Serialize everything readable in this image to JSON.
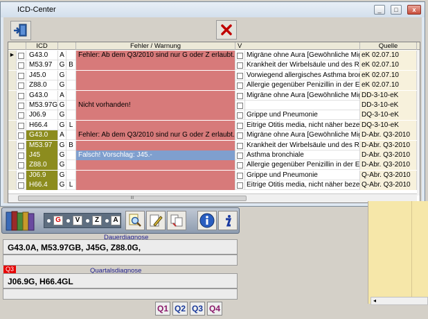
{
  "window": {
    "title": "ICD-Center",
    "btn_min": "_",
    "btn_max": "□",
    "btn_close": "x"
  },
  "grid": {
    "columns": {
      "icd": "ICD",
      "error": "Fehler / Warnung",
      "v": "V",
      "source": "Quelle"
    },
    "scroll_mark": "III",
    "rows": [
      {
        "icd": "G43.0",
        "k1": "A",
        "k2": "",
        "error": "Fehler: Ab dem Q3/2010 sind nur G oder Z erlaubt.",
        "desc": "Migräne ohne Aura [Gewöhnliche Migräne]",
        "source": "eK 02.07.10",
        "dark": false,
        "status": "error"
      },
      {
        "icd": "M53.97",
        "k1": "G",
        "k2": "B",
        "error": "",
        "desc": "Krankheit der Wirbelsäule und des Rückens",
        "source": "eK 02.07.10",
        "dark": false,
        "status": "error"
      },
      {
        "icd": "J45.0",
        "k1": "G",
        "k2": "",
        "error": "",
        "desc": "Vorwiegend allergisches Asthma bronchiale",
        "source": "eK 02.07.10",
        "dark": false,
        "status": "error"
      },
      {
        "icd": "Z88.0",
        "k1": "G",
        "k2": "",
        "error": "",
        "desc": "Allergie gegenüber Penizillin in der Eigenanamnese",
        "source": "eK 02.07.10",
        "dark": false,
        "status": "error"
      },
      {
        "icd": "G43.0",
        "k1": "A",
        "k2": "",
        "error": "",
        "desc": "Migräne ohne Aura [Gewöhnliche Migräne]",
        "source": "DD-3-10-eK",
        "dark": false,
        "status": "error"
      },
      {
        "icd": "M53.97G",
        "k1": "G",
        "k2": "",
        "error": "Nicht vorhanden!",
        "desc": "",
        "source": "DD-3-10-eK",
        "dark": false,
        "status": "error"
      },
      {
        "icd": "J06.9",
        "k1": "G",
        "k2": "",
        "error": "",
        "desc": "Grippe und Pneumonie",
        "source": "DQ-3-10-eK",
        "dark": false,
        "status": "error"
      },
      {
        "icd": "H66.4",
        "k1": "G",
        "k2": "L",
        "error": "",
        "desc": "Eitrige Otitis media, nicht näher bezeichnet",
        "source": "DQ-3-10-eK",
        "dark": false,
        "status": "error"
      },
      {
        "icd": "G43.0",
        "k1": "A",
        "k2": "",
        "error": "Fehler: Ab dem Q3/2010 sind nur G oder Z erlaubt.",
        "desc": "Migräne ohne Aura [Gewöhnliche Migräne]",
        "source": "D-Abr. Q3-2010",
        "dark": true,
        "status": "error"
      },
      {
        "icd": "M53.97",
        "k1": "G",
        "k2": "B",
        "error": "",
        "desc": "Krankheit der Wirbelsäule und des Rückens",
        "source": "D-Abr. Q3-2010",
        "dark": true,
        "status": "error"
      },
      {
        "icd": "J45",
        "k1": "G",
        "k2": "",
        "error": "Falsch!      Vorschlag: J45.-",
        "desc": "Asthma bronchiale",
        "source": "D-Abr. Q3-2010",
        "dark": true,
        "status": "ok"
      },
      {
        "icd": "Z88.0",
        "k1": "G",
        "k2": "",
        "error": "",
        "desc": "Allergie gegenüber Penizillin in der Eigenanamnese",
        "source": "D-Abr. Q3-2010",
        "dark": true,
        "status": "error"
      },
      {
        "icd": "J06.9",
        "k1": "G",
        "k2": "",
        "error": "",
        "desc": "Grippe und Pneumonie",
        "source": "Q-Abr. Q3-2010",
        "dark": true,
        "status": "error"
      },
      {
        "icd": "H66.4",
        "k1": "G",
        "k2": "L",
        "error": "",
        "desc": "Eitrige Otitis media, nicht näher bezeichnet",
        "source": "Q-Abr. Q3-2010",
        "dark": true,
        "status": "error"
      }
    ]
  },
  "filters": [
    "G",
    "V",
    "Z",
    "A"
  ],
  "dauer": {
    "label": "Dauerdiagnose",
    "value": "G43.0A, M53.97GB, J45G, Z88.0G,"
  },
  "quartal": {
    "tag": "Q3",
    "label": "Quartalsdiagnose",
    "value": "J06.9G, H66.4GL"
  },
  "quarters": [
    "Q1",
    "Q2",
    "Q3",
    "Q4"
  ],
  "right_panel": {
    "scroll_arrow": "◂"
  },
  "colors": {
    "error": "#d77a7a",
    "suggestion": "#7f9fce",
    "dark_icd": "#8c8c1e",
    "filter_g": "#d80000",
    "quarter": "#8b1a6b"
  }
}
